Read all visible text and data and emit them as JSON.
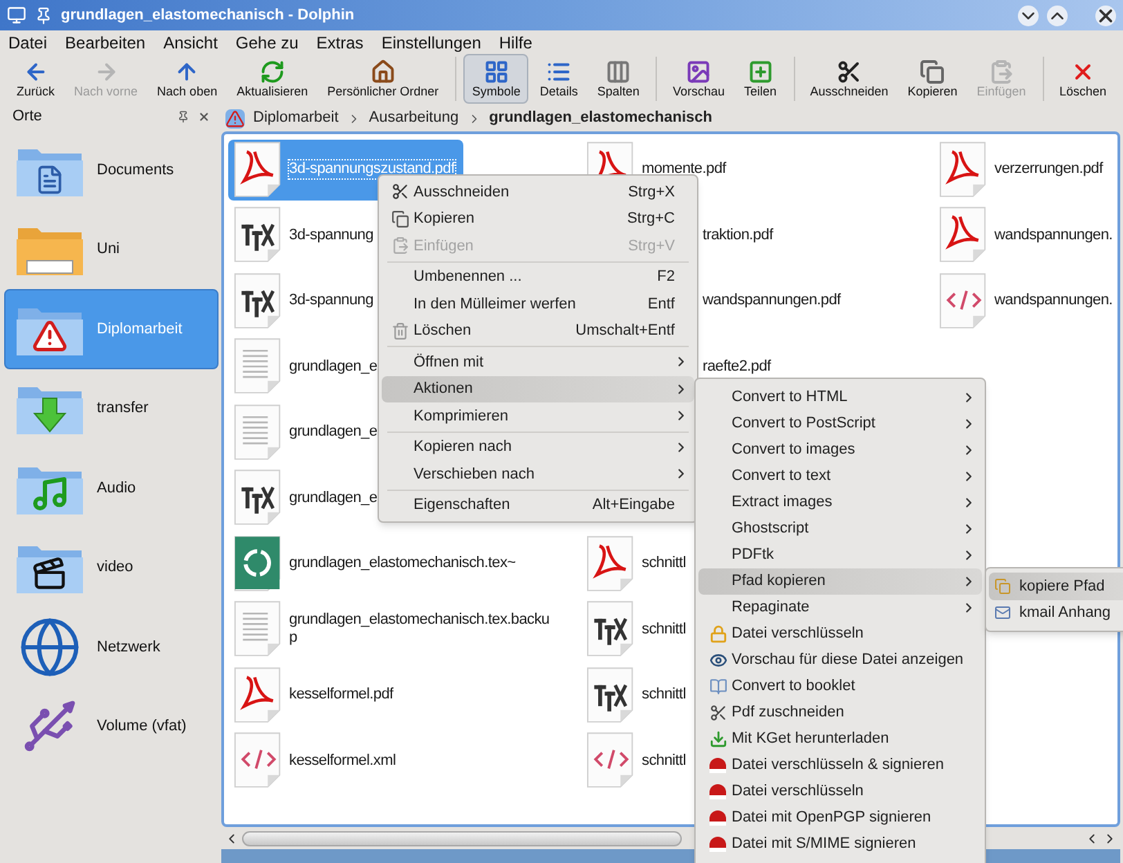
{
  "window": {
    "title": "grundlagen_elastomechanisch - Dolphin"
  },
  "menubar": [
    "Datei",
    "Bearbeiten",
    "Ansicht",
    "Gehe zu",
    "Extras",
    "Einstellungen",
    "Hilfe"
  ],
  "toolbar": {
    "navigation": [
      {
        "label": "Zurück",
        "disabled": false
      },
      {
        "label": "Nach vorne",
        "disabled": true
      },
      {
        "label": "Nach oben",
        "disabled": false
      },
      {
        "label": "Aktualisieren",
        "disabled": false
      },
      {
        "label": "Persönlicher Ordner",
        "disabled": false
      }
    ],
    "view_modes": [
      {
        "label": "Symbole",
        "selected": true
      },
      {
        "label": "Details",
        "selected": false
      },
      {
        "label": "Spalten",
        "selected": false
      }
    ],
    "tools": [
      "Vorschau",
      "Teilen"
    ],
    "edit": [
      {
        "label": "Ausschneiden",
        "disabled": false
      },
      {
        "label": "Kopieren",
        "disabled": false
      },
      {
        "label": "Einfügen",
        "disabled": true
      }
    ],
    "delete": "Löschen"
  },
  "places": {
    "title": "Orte",
    "items": [
      {
        "label": "Documents",
        "selected": false,
        "kind": "folder"
      },
      {
        "label": "Uni",
        "selected": false,
        "kind": "folder"
      },
      {
        "label": "Diplomarbeit",
        "selected": true,
        "kind": "folder"
      },
      {
        "label": "transfer",
        "selected": false,
        "kind": "folder"
      },
      {
        "label": "Audio",
        "selected": false,
        "kind": "folder"
      },
      {
        "label": "video",
        "selected": false,
        "kind": "folder"
      },
      {
        "label": "Netzwerk",
        "selected": false,
        "kind": "network"
      },
      {
        "label": "Volume (vfat)",
        "selected": false,
        "kind": "drive"
      }
    ]
  },
  "breadcrumb": [
    "Diplomarbeit",
    "Ausarbeitung",
    "grundlagen_elastomechanisch"
  ],
  "files": [
    {
      "top": [
        {
          "name": "3d-spannungszustand.pdf",
          "kind": "pdf",
          "selected": true
        },
        {
          "name": "3d-spannung",
          "kind": "tex",
          "selected": false
        },
        {
          "name": "3d-spannung",
          "kind": "tex",
          "selected": false
        },
        {
          "name": "grundlagen_e",
          "kind": "text",
          "selected": false
        },
        {
          "name": "grundlagen_e",
          "kind": "text",
          "selected": false
        },
        {
          "name": "grundlagen_e",
          "kind": "tex",
          "selected": false
        },
        {
          "name": "grundlagen_elastomechanisch.tex~",
          "kind": "trash",
          "selected": false
        },
        {
          "name": "grundlagen_elastomechanisch.tex.backup",
          "kind": "text",
          "selected": false
        },
        {
          "name": "kesselformel.pdf",
          "kind": "pdf",
          "selected": false
        },
        {
          "name": "kesselformel.xml",
          "kind": "xml",
          "selected": false
        }
      ]
    },
    {
      "top": [
        {
          "name": "momente.pdf",
          "kind": "pdf",
          "selected": false
        },
        {
          "name": "traktion.pdf",
          "kind": "covered",
          "selected": false
        },
        {
          "name": "wandspannungen.pdf",
          "kind": "covered",
          "selected": false
        },
        {
          "name": "raefte2.pdf",
          "kind": "covered",
          "selected": false
        }
      ],
      "bottom": [
        {
          "name": "schnittl",
          "kind": "pdf",
          "selected": false
        },
        {
          "name": "schnittl",
          "kind": "tex",
          "selected": false
        },
        {
          "name": "schnittl",
          "kind": "tex",
          "selected": false
        },
        {
          "name": "schnittl",
          "kind": "xml",
          "selected": false
        }
      ]
    },
    {
      "top": [
        {
          "name": "verzerrungen.pdf",
          "kind": "pdf",
          "selected": false
        },
        {
          "name": "wandspannungen.",
          "kind": "pdf",
          "selected": false
        },
        {
          "name": "wandspannungen.",
          "kind": "xml",
          "selected": false
        }
      ]
    }
  ],
  "context_menu": {
    "items": [
      {
        "kind": "item",
        "label": "Ausschneiden",
        "shortcut": "Strg+X",
        "disabled": false,
        "selected": false,
        "submenu": false
      },
      {
        "kind": "item",
        "label": "Kopieren",
        "shortcut": "Strg+C",
        "disabled": false,
        "selected": false,
        "submenu": false
      },
      {
        "kind": "item",
        "label": "Einfügen",
        "shortcut": "Strg+V",
        "disabled": true,
        "selected": false,
        "submenu": false
      },
      {
        "kind": "separator"
      },
      {
        "kind": "item",
        "label": "Umbenennen ...",
        "shortcut": "F2",
        "disabled": false,
        "selected": false,
        "submenu": false
      },
      {
        "kind": "item",
        "label": "In den Mülleimer werfen",
        "shortcut": "Entf",
        "disabled": false,
        "selected": false,
        "submenu": false
      },
      {
        "kind": "item",
        "label": "Löschen",
        "shortcut": "Umschalt+Entf",
        "disabled": false,
        "selected": false,
        "submenu": false
      },
      {
        "kind": "separator"
      },
      {
        "kind": "item",
        "label": "Öffnen mit",
        "disabled": false,
        "selected": false,
        "submenu": true
      },
      {
        "kind": "item",
        "label": "Aktionen",
        "disabled": false,
        "selected": true,
        "submenu": true
      },
      {
        "kind": "item",
        "label": "Komprimieren",
        "disabled": false,
        "selected": false,
        "submenu": true
      },
      {
        "kind": "separator"
      },
      {
        "kind": "item",
        "label": "Kopieren nach",
        "disabled": false,
        "selected": false,
        "submenu": true
      },
      {
        "kind": "item",
        "label": "Verschieben nach",
        "disabled": false,
        "selected": false,
        "submenu": true
      },
      {
        "kind": "separator"
      },
      {
        "kind": "item",
        "label": "Eigenschaften",
        "shortcut": "Alt+Eingabe",
        "disabled": false,
        "selected": false,
        "submenu": false
      }
    ]
  },
  "actions_menu": {
    "items": [
      {
        "label": "Convert to HTML",
        "selected": false,
        "submenu": true
      },
      {
        "label": "Convert to PostScript",
        "selected": false,
        "submenu": true
      },
      {
        "label": "Convert to images",
        "selected": false,
        "submenu": true
      },
      {
        "label": "Convert to text",
        "selected": false,
        "submenu": true
      },
      {
        "label": "Extract images",
        "selected": false,
        "submenu": true
      },
      {
        "label": "Ghostscript",
        "selected": false,
        "submenu": true
      },
      {
        "label": "PDFtk",
        "selected": false,
        "submenu": true
      },
      {
        "label": "Pfad kopieren",
        "selected": true,
        "submenu": true
      },
      {
        "label": "Repaginate",
        "selected": false,
        "submenu": true
      },
      {
        "label": "Datei verschlüsseln",
        "selected": false,
        "submenu": false
      },
      {
        "label": "Vorschau für diese Datei anzeigen",
        "selected": false,
        "submenu": false
      },
      {
        "label": "Convert to booklet",
        "selected": false,
        "submenu": false
      },
      {
        "label": "Pdf zuschneiden",
        "selected": false,
        "submenu": false
      },
      {
        "label": "Mit KGet herunterladen",
        "selected": false,
        "submenu": false
      },
      {
        "label": "Datei verschlüsseln & signieren",
        "selected": false,
        "submenu": false
      },
      {
        "label": "Datei verschlüsseln",
        "selected": false,
        "submenu": false
      },
      {
        "label": "Datei mit OpenPGP signieren",
        "selected": false,
        "submenu": false
      },
      {
        "label": "Datei mit S/MIME signieren",
        "selected": false,
        "submenu": false
      }
    ]
  },
  "path_menu": {
    "items": [
      {
        "label": "kopiere Pfad",
        "selected": true
      },
      {
        "label": "kmail Anhang",
        "selected": false
      }
    ]
  }
}
